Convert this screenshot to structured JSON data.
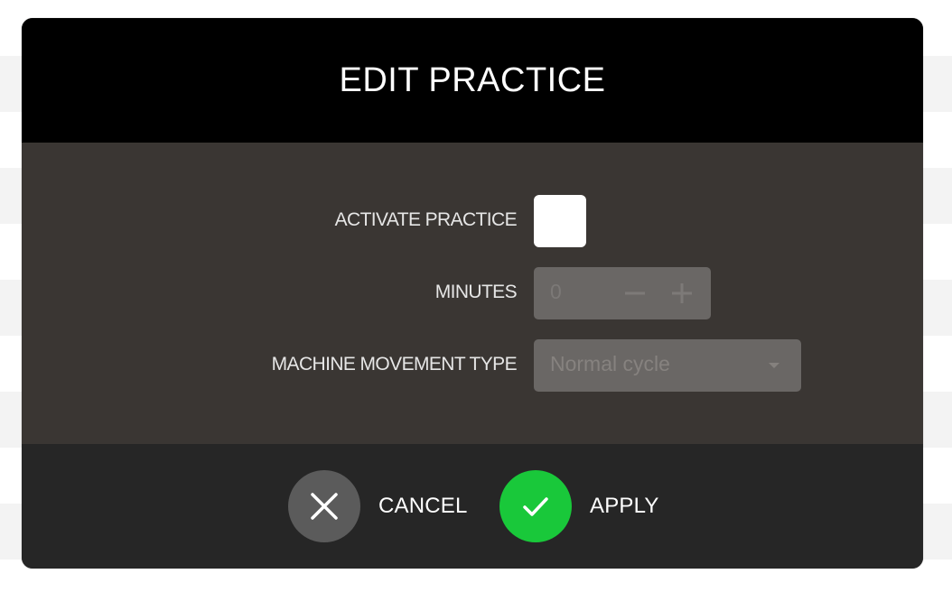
{
  "dialog": {
    "title": "EDIT PRACTICE"
  },
  "form": {
    "activate_practice": {
      "label": "ACTIVATE PRACTICE",
      "checked": false
    },
    "minutes": {
      "label": "MINUTES",
      "value": "0",
      "decrement_symbol": "minus-icon",
      "increment_symbol": "plus-icon"
    },
    "machine_movement_type": {
      "label": "MACHINE MOVEMENT TYPE",
      "selected": "Normal cycle"
    }
  },
  "actions": {
    "cancel_label": "CANCEL",
    "apply_label": "APPLY"
  },
  "colors": {
    "header_bg": "#000000",
    "body_bg": "#3a3633",
    "footer_bg": "#262626",
    "input_bg": "#6a6765",
    "cancel_circle": "#5b5b5b",
    "apply_circle": "#19c83a"
  }
}
